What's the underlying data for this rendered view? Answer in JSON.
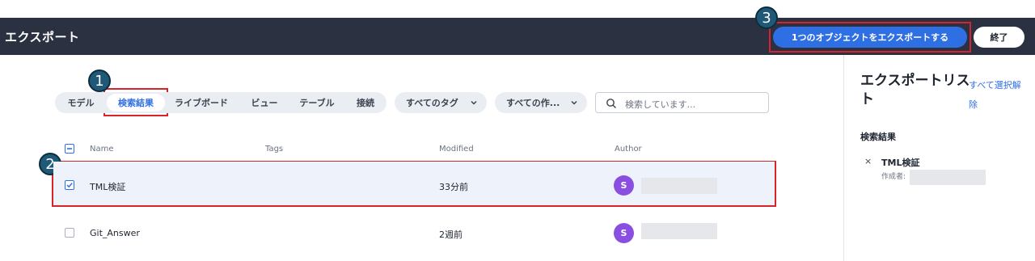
{
  "header": {
    "title": "エクスポート",
    "export_button": "1つのオブジェクトをエクスポートする",
    "done_button": "終了"
  },
  "annotations": {
    "marker1": "1",
    "marker2": "2",
    "marker3": "3"
  },
  "tabs": [
    {
      "label": "モデル",
      "active": false
    },
    {
      "label": "検索結果",
      "active": true
    },
    {
      "label": "ライブボード",
      "active": false
    },
    {
      "label": "ビュー",
      "active": false
    },
    {
      "label": "テーブル",
      "active": false
    },
    {
      "label": "接続",
      "active": false
    }
  ],
  "filters": {
    "tags": "すべてのタグ",
    "creators": "すべての作..."
  },
  "search": {
    "placeholder": "検索しています..."
  },
  "table": {
    "columns": {
      "name": "Name",
      "tags": "Tags",
      "modified": "Modified",
      "author": "Author"
    },
    "rows": [
      {
        "name": "TML検証",
        "modified": "33分前",
        "avatar": "S",
        "checked": true
      },
      {
        "name": "Git_Answer",
        "modified": "2週前",
        "avatar": "S",
        "checked": false
      }
    ]
  },
  "export_list": {
    "title": "エクスポートリスト",
    "deselect_all": "すべて選択解除",
    "section": "検索結果",
    "item_remove": "×",
    "item_name": "TML検証",
    "item_author_label": "作成者:"
  },
  "colors": {
    "header_bg": "#2b3140",
    "accent": "#2f6fe4",
    "highlight": "#d8232a",
    "marker_bg": "#1f5977",
    "avatar": "#8a4fe0"
  }
}
